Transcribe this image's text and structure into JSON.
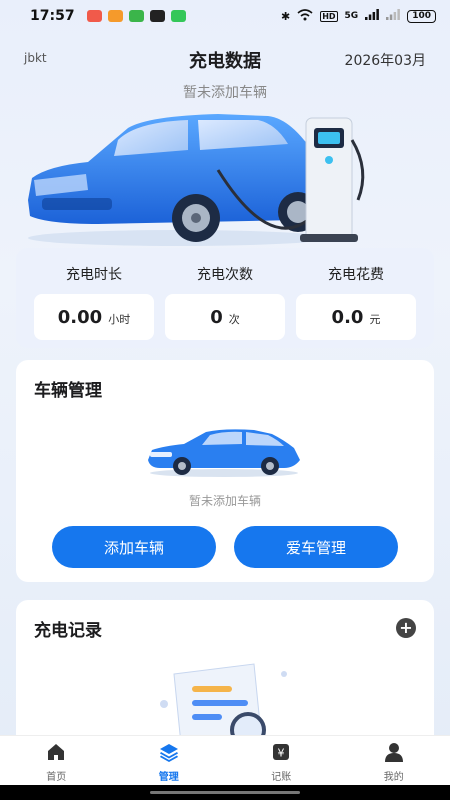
{
  "status_bar": {
    "time": "17:57",
    "battery": "100",
    "network": "5G",
    "hd": "HD",
    "app_icon_colors": [
      "#f15a4a",
      "#f59a2b",
      "#3bb54a",
      "#222222",
      "#34c759"
    ]
  },
  "header": {
    "username": "jbkt",
    "title": "充电数据",
    "month": "2026年03月",
    "subtitle": "暂未添加车辆"
  },
  "stats": [
    {
      "label": "充电时长",
      "value": "0.00",
      "unit": "小时"
    },
    {
      "label": "充电次数",
      "value": "0",
      "unit": "次"
    },
    {
      "label": "充电花费",
      "value": "0.0",
      "unit": "元"
    }
  ],
  "vehicle_card": {
    "title": "车辆管理",
    "empty_text": "暂未添加车辆",
    "add_button": "添加车辆",
    "manage_button": "爱车管理"
  },
  "records_card": {
    "title": "充电记录",
    "add_icon": "plus-circle-icon"
  },
  "tabs": [
    {
      "label": "首页",
      "icon": "home-icon",
      "active": false
    },
    {
      "label": "管理",
      "icon": "layers-icon",
      "active": true
    },
    {
      "label": "记账",
      "icon": "ledger-icon",
      "active": false
    },
    {
      "label": "我的",
      "icon": "user-icon",
      "active": false
    }
  ],
  "colors": {
    "accent": "#1677ee",
    "car_body": "#2a7ff0",
    "background": "#e9effb"
  }
}
